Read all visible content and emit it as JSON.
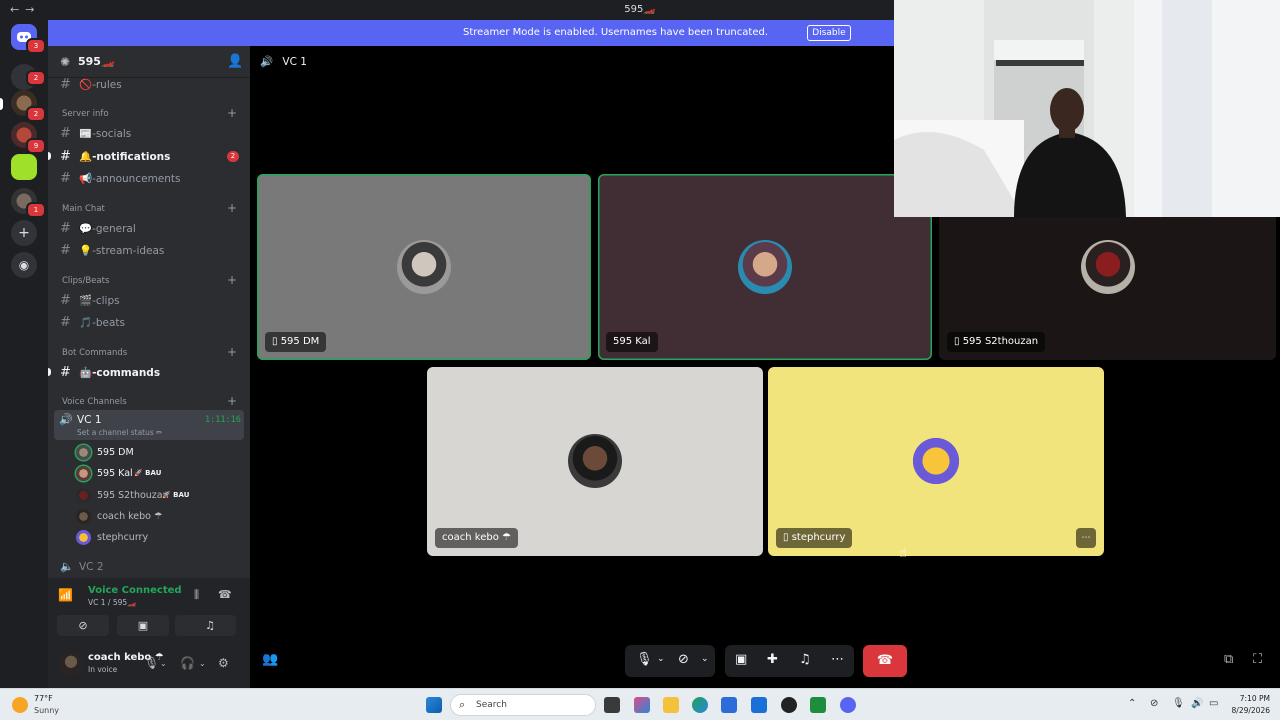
{
  "window": {
    "title": "595🏎️",
    "nav_back": "←",
    "nav_forward": "→"
  },
  "banner": {
    "text": "Streamer Mode is enabled. Usernames have been truncated.",
    "button": "Disable"
  },
  "rail": {
    "badges": [
      "3",
      "2",
      "2",
      "9",
      "1"
    ]
  },
  "server": {
    "name": "595🏎️"
  },
  "channels": {
    "rules": "🚫-rules",
    "cat_server_info": "Server info",
    "socials": "📰-socials",
    "notifications": "🔔-notifications",
    "notifications_count": "2",
    "announcements": "📢-announcements",
    "cat_main_chat": "Main Chat",
    "general": "💬-general",
    "stream_ideas": "💡-stream-ideas",
    "cat_clips_beats": "Clips/Beats",
    "clips": "🎬-clips",
    "beats": "🎵-beats",
    "cat_bot_commands": "Bot Commands",
    "commands": "🤖-commands",
    "cat_voice": "Voice Channels",
    "vc1": "VC 1",
    "vc1_timer": "1:11:16",
    "vc1_status": "Set a channel status ✏",
    "vc2": "VC 2"
  },
  "voice_users": [
    {
      "name": "595 DM",
      "tag": ""
    },
    {
      "name": "595 Kal",
      "tag": "🚀 BAU"
    },
    {
      "name": "595 S2thouzan",
      "tag": "🚀 BAU"
    },
    {
      "name": "coach kebo ☂",
      "tag": ""
    },
    {
      "name": "stephcurry",
      "tag": ""
    }
  ],
  "voice_panel": {
    "title": "Voice Connected",
    "subtitle": "VC 1 / 595🏎️"
  },
  "user": {
    "name": "coach kebo ☂",
    "status": "In voice"
  },
  "call": {
    "channel": "VC 1",
    "tiles": [
      {
        "name": "595 DM",
        "mobile": true
      },
      {
        "name": "595 Kal",
        "mobile": false
      },
      {
        "name": "595 S2thouzan",
        "mobile": true
      },
      {
        "name": "coach kebo ☂",
        "mobile": false
      },
      {
        "name": "stephcurry",
        "mobile": true
      }
    ],
    "more": "⋯"
  },
  "taskbar": {
    "temp": "77°F",
    "condition": "Sunny",
    "search_placeholder": "Search",
    "time": "7:10 PM",
    "date": "8/29/2026"
  },
  "colors": {
    "accent": "#5865f2",
    "speaking": "#23a55a",
    "danger": "#da373c",
    "sidebar": "#2b2d31",
    "rail": "#1e1f22"
  }
}
